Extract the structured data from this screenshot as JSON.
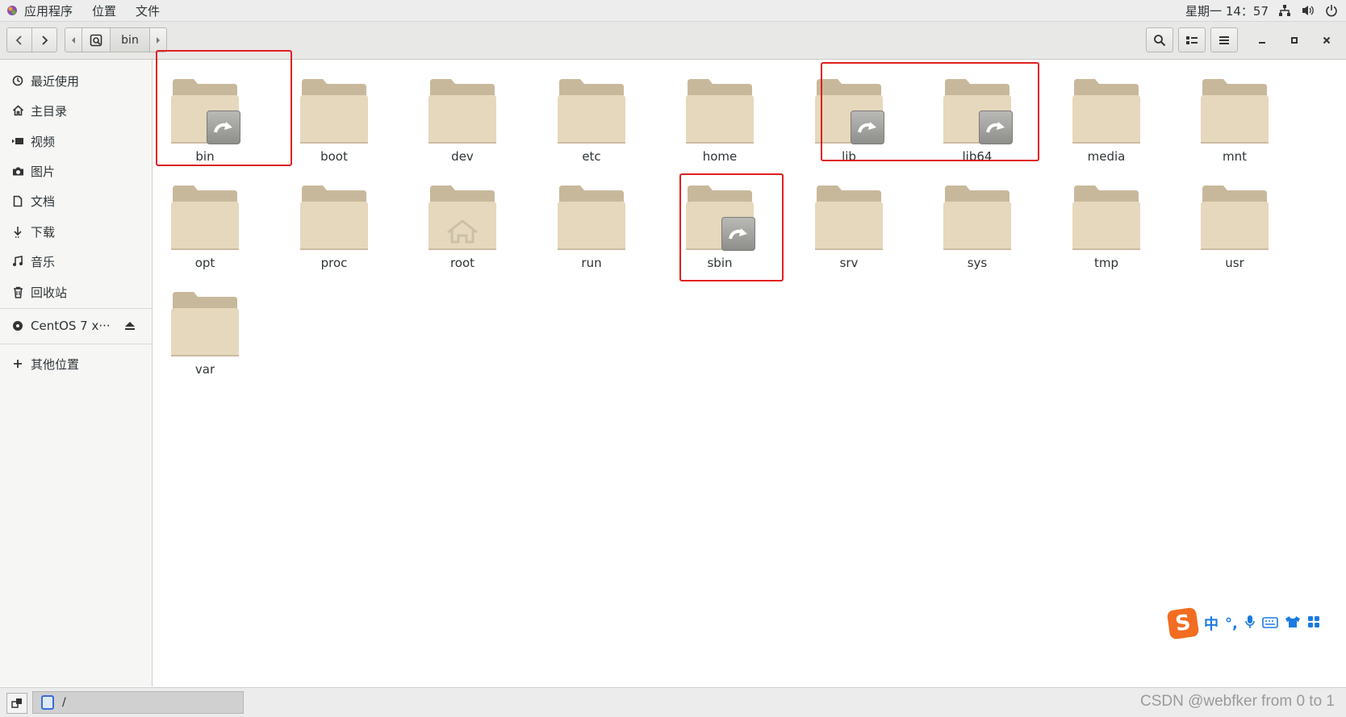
{
  "top_panel": {
    "menus": [
      "应用程序",
      "位置",
      "文件"
    ],
    "clock": "星期一 14：57",
    "icons": [
      "network-icon",
      "volume-icon",
      "power-icon"
    ]
  },
  "headerbar": {
    "path_current": "bin",
    "buttons": [
      "back-icon",
      "forward-icon",
      "search-icon",
      "view-list-icon",
      "menu-icon"
    ],
    "window_controls": [
      "minimize-icon",
      "maximize-icon",
      "close-icon"
    ]
  },
  "sidebar": {
    "places": [
      {
        "label": "最近使用",
        "icon": "recent-icon"
      },
      {
        "label": "主目录",
        "icon": "home-icon"
      },
      {
        "label": "视频",
        "icon": "video-icon"
      },
      {
        "label": "图片",
        "icon": "camera-icon"
      },
      {
        "label": "文档",
        "icon": "document-icon"
      },
      {
        "label": "下载",
        "icon": "download-icon"
      },
      {
        "label": "音乐",
        "icon": "music-icon"
      },
      {
        "label": "回收站",
        "icon": "trash-icon"
      }
    ],
    "device": {
      "label": "CentOS 7 x···",
      "icon": "disc-icon"
    },
    "other": {
      "label": "其他位置",
      "icon": "plus-icon"
    }
  },
  "files": [
    {
      "name": "bin",
      "symlink": true
    },
    {
      "name": "boot",
      "symlink": false
    },
    {
      "name": "dev",
      "symlink": false
    },
    {
      "name": "etc",
      "symlink": false
    },
    {
      "name": "home",
      "symlink": false
    },
    {
      "name": "lib",
      "symlink": true
    },
    {
      "name": "lib64",
      "symlink": true
    },
    {
      "name": "media",
      "symlink": false
    },
    {
      "name": "mnt",
      "symlink": false
    },
    {
      "name": "opt",
      "symlink": false
    },
    {
      "name": "proc",
      "symlink": false
    },
    {
      "name": "root",
      "symlink": false,
      "home_emblem": true
    },
    {
      "name": "run",
      "symlink": false
    },
    {
      "name": "sbin",
      "symlink": true
    },
    {
      "name": "srv",
      "symlink": false
    },
    {
      "name": "sys",
      "symlink": false
    },
    {
      "name": "tmp",
      "symlink": false
    },
    {
      "name": "usr",
      "symlink": false
    },
    {
      "name": "var",
      "symlink": false
    }
  ],
  "ime_toolbar": {
    "logo": "S",
    "mode": "中",
    "punct": "°,"
  },
  "bottom_bar": {
    "task_label": "/",
    "watermark": "CSDN @webfker from 0 to 1"
  },
  "colors": {
    "folder_back": "#c8b89b",
    "folder_front": "#e6d8bd",
    "highlight": "#e02020"
  }
}
